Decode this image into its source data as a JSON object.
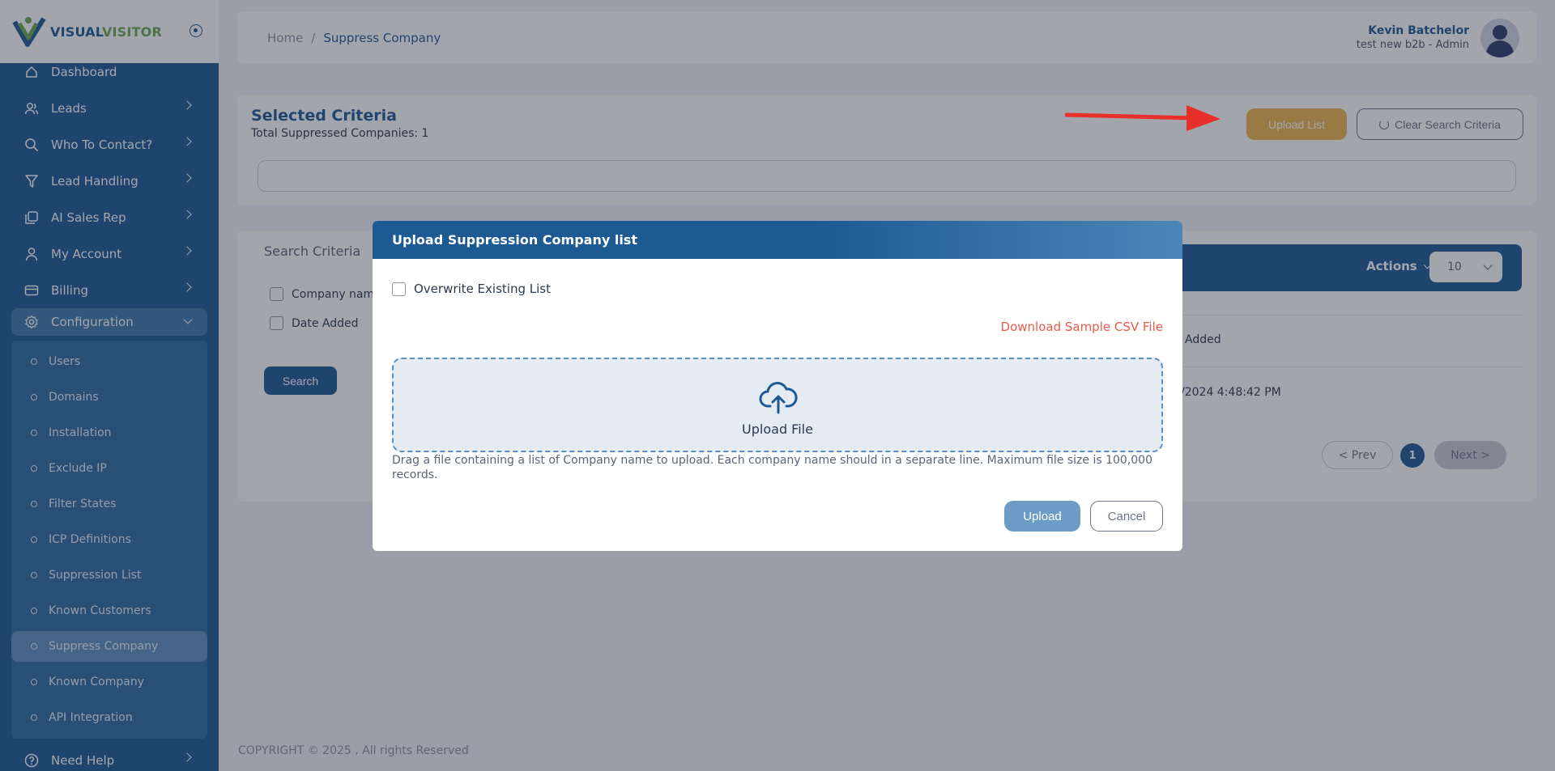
{
  "app": {
    "logo_part1": "VISUAL",
    "logo_part2": "VISITOR"
  },
  "sidebar": {
    "items": [
      {
        "label": "Dashboard",
        "icon": "home-icon"
      },
      {
        "label": "Leads",
        "icon": "users-icon"
      },
      {
        "label": "Who To Contact?",
        "icon": "search-icon"
      },
      {
        "label": "Lead Handling",
        "icon": "filter-icon"
      },
      {
        "label": "AI Sales Rep",
        "icon": "copy-icon"
      },
      {
        "label": "My Account",
        "icon": "user-icon"
      },
      {
        "label": "Billing",
        "icon": "card-icon"
      },
      {
        "label": "Configuration",
        "icon": "gear-icon"
      }
    ],
    "submenu": [
      "Users",
      "Domains",
      "Installation",
      "Exclude IP",
      "Filter States",
      "ICP Definitions",
      "Suppression List",
      "Known Customers",
      "Suppress Company",
      "Known Company",
      "API Integration"
    ],
    "help": "Need Help"
  },
  "header": {
    "breadcrumb_home": "Home",
    "breadcrumb_sep": "/",
    "breadcrumb_current": "Suppress Company",
    "user_name": "Kevin Batchelor",
    "user_role": "test new b2b - Admin"
  },
  "criteria": {
    "title": "Selected Criteria",
    "subtitle": "Total Suppressed Companies: 1",
    "upload_list": "Upload List",
    "clear": "Clear Search Criteria"
  },
  "search": {
    "title": "Search Criteria",
    "options": [
      "Company nam",
      "Date Added"
    ],
    "button": "Search",
    "actions": "Actions",
    "page_size": "10",
    "col_added": "Added",
    "cell_date": "/2024 4:48:42 PM",
    "prev": "< Prev",
    "page": "1",
    "next": "Next >"
  },
  "footer": "COPYRIGHT © 2025 , All rights Reserved",
  "modal": {
    "title": "Upload Suppression Company list",
    "overwrite": "Overwrite Existing List",
    "download": "Download Sample CSV File",
    "dropzone_label": "Upload File",
    "hint": "Drag a file containing a list of Company name to upload. Each company name should in a separate line. Maximum file size is 100,000 records.",
    "upload": "Upload",
    "cancel": "Cancel"
  },
  "colors": {
    "primary": "#1d5a93",
    "accent": "#f0b64a",
    "link": "#e85a4a",
    "arrow": "#e8302a"
  }
}
